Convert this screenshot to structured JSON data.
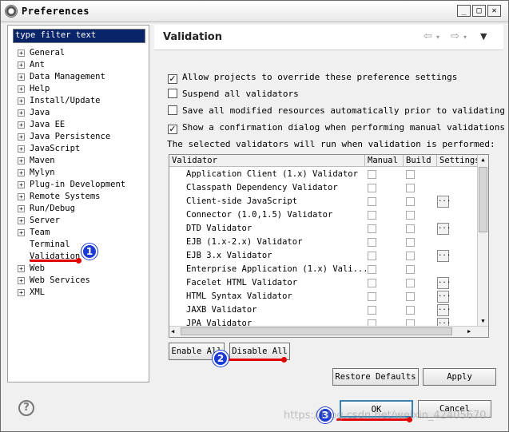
{
  "window": {
    "title": "Preferences",
    "minimize_icon": "minimize-icon",
    "maximize_icon": "maximize-icon",
    "close_icon": "close-icon"
  },
  "left_pane": {
    "filter_placeholder": "type filter text",
    "tree": [
      {
        "label": "General",
        "expandable": true
      },
      {
        "label": "Ant",
        "expandable": true
      },
      {
        "label": "Data Management",
        "expandable": true
      },
      {
        "label": "Help",
        "expandable": true
      },
      {
        "label": "Install/Update",
        "expandable": true
      },
      {
        "label": "Java",
        "expandable": true
      },
      {
        "label": "Java EE",
        "expandable": true
      },
      {
        "label": "Java Persistence",
        "expandable": true
      },
      {
        "label": "JavaScript",
        "expandable": true
      },
      {
        "label": "Maven",
        "expandable": true
      },
      {
        "label": "Mylyn",
        "expandable": true
      },
      {
        "label": "Plug-in Development",
        "expandable": true
      },
      {
        "label": "Remote Systems",
        "expandable": true
      },
      {
        "label": "Run/Debug",
        "expandable": true
      },
      {
        "label": "Server",
        "expandable": true
      },
      {
        "label": "Team",
        "expandable": true
      },
      {
        "label": "Terminal",
        "expandable": false
      },
      {
        "label": "Validation",
        "expandable": false,
        "selected": true
      },
      {
        "label": "Web",
        "expandable": true
      },
      {
        "label": "Web Services",
        "expandable": true
      },
      {
        "label": "XML",
        "expandable": true
      }
    ]
  },
  "right_pane": {
    "title": "Validation",
    "options": [
      {
        "label": "Allow projects to override these preference settings",
        "checked": true
      },
      {
        "label": "Suspend all validators",
        "checked": false
      },
      {
        "label": "Save all modified resources automatically prior to validating",
        "checked": false
      },
      {
        "label": "Show a confirmation dialog when performing manual validations",
        "checked": true
      }
    ],
    "info_text": "The selected validators will run when validation is performed:",
    "table": {
      "columns": [
        "Validator",
        "Manual",
        "Build",
        "Settings"
      ],
      "rows": [
        {
          "name": "Application Client (1.x) Validator",
          "settings": false
        },
        {
          "name": "Classpath Dependency Validator",
          "settings": false
        },
        {
          "name": "Client-side JavaScript",
          "settings": true
        },
        {
          "name": "Connector (1.0,1.5) Validator",
          "settings": false
        },
        {
          "name": "DTD Validator",
          "settings": true
        },
        {
          "name": "EJB (1.x-2.x) Validator",
          "settings": false
        },
        {
          "name": "EJB 3.x Validator",
          "settings": true
        },
        {
          "name": "Enterprise Application (1.x) Vali...",
          "settings": false
        },
        {
          "name": "Facelet HTML Validator",
          "settings": true
        },
        {
          "name": "HTML Syntax Validator",
          "settings": true
        },
        {
          "name": "JAXB Validator",
          "settings": true
        },
        {
          "name": "JPA Validator",
          "settings": true
        }
      ]
    },
    "enable_all": "Enable All",
    "disable_all": "Disable All",
    "restore_defaults": "Restore Defaults",
    "apply": "Apply"
  },
  "bottom": {
    "ok": "OK",
    "cancel": "Cancel",
    "help_icon": "help-icon"
  },
  "annotations": {
    "badge1": "1",
    "badge2": "2",
    "badge3": "3",
    "color": "#1c3ad4",
    "line_color": "#e00000"
  },
  "watermark": "https://blog.csdn.net/weixin_42405670"
}
